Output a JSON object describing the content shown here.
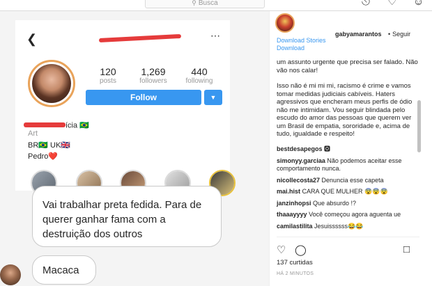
{
  "topbar": {
    "search_placeholder": "Busca",
    "search_icon": "search-icon",
    "icons": [
      "compass-icon",
      "heart-icon",
      "user-icon"
    ]
  },
  "screenshot": {
    "profile": {
      "posts": "120",
      "posts_label": "posts",
      "followers": "1,269",
      "followers_label": "followers",
      "following": "440",
      "following_label": "following",
      "follow_label": "Follow",
      "name_suffix": "ícia 🇧🇷",
      "bio_lines": [
        "Art",
        "BR🇧🇷 UK🇬🇧",
        "Pedro❤️"
      ]
    },
    "comments": [
      "Vai trabalhar preta fedida. Para de querer ganhar fama com a destruição dos outros",
      "Macaca"
    ]
  },
  "post": {
    "author": "gabyamarantos",
    "follow": "Seguir",
    "download_stories": "Download Stories",
    "download": "Download",
    "caption_paragraphs": [
      "um assunto urgente que precisa ser falado. Não vão nos calar!",
      "Isso não é mi mi mi, racismo é crime e vamos tomar medidas judiciais cabíveis. Haters agressivos que encheram meus perfis de ódio não me intimidam. Vou seguir blindada pelo escudo do amor das pessoas que querem ver um Brasil de empatia, sororidade e, acima de tudo, igualdade e respeito!"
    ],
    "comments": [
      {
        "user": "bestdesapegos",
        "text": "🅾"
      },
      {
        "user": "simonyy.garciaa",
        "text": "Não podemos aceitar esse comportamento nunca."
      },
      {
        "user": "nicollecosta27",
        "text": "Denuncia esse capeta"
      },
      {
        "user": "mai.hist",
        "text": "CARA QUE MULHER 😨😨😨"
      },
      {
        "user": "janzinhopsi",
        "text": "Que absurdo !?"
      },
      {
        "user": "thaaayyyy",
        "text": "Você começou agora aguenta ue"
      },
      {
        "user": "camilastilita",
        "text": "Jesuissssss😂😂"
      }
    ],
    "likes": "137 curtidas",
    "time": "HÁ 2 MINUTOS"
  }
}
